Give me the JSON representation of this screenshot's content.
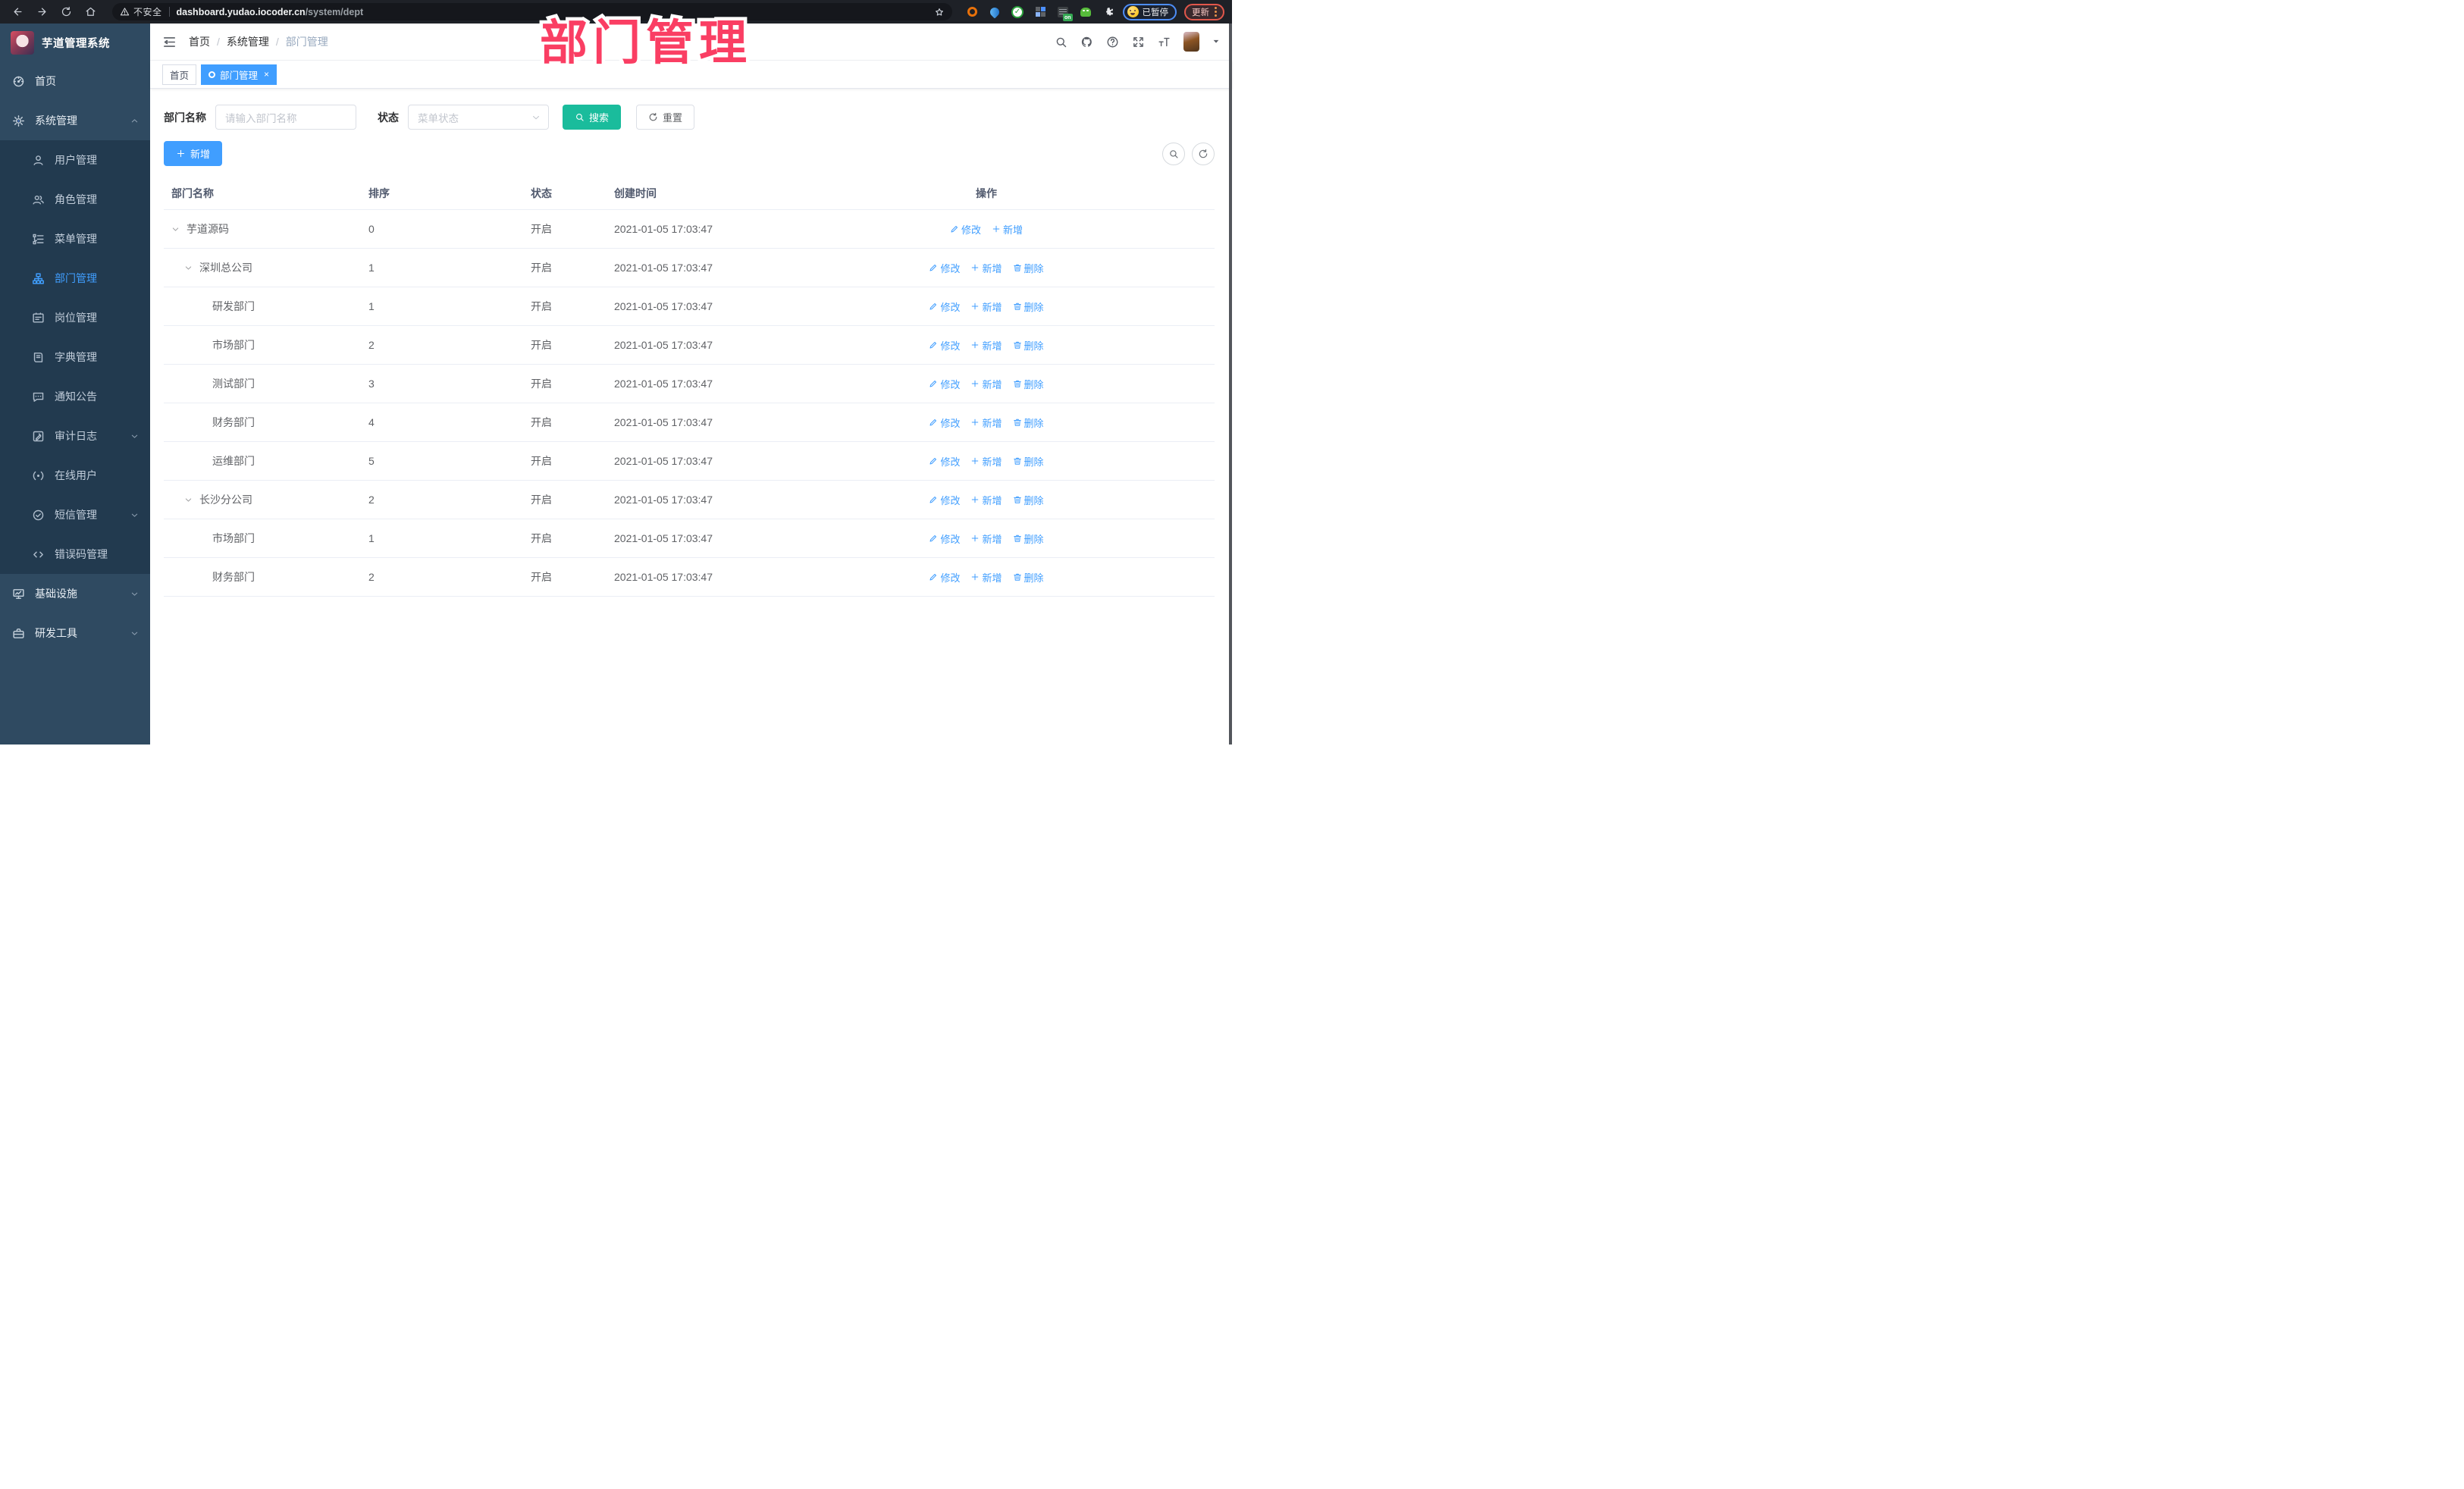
{
  "annotation": {
    "title": "部门管理"
  },
  "browser": {
    "insecure_label": "不安全",
    "url_host": "dashboard.yudao.iocoder.cn",
    "url_path": "/system/dept",
    "profile_label": "已暂停",
    "update_label": "更新",
    "extensions": [
      {
        "icon": "orange-ring-extension-icon"
      },
      {
        "icon": "blue-pin-extension-icon"
      },
      {
        "icon": "green-check-extension-icon"
      },
      {
        "icon": "grid-extension-icon"
      },
      {
        "icon": "adblock-extension-icon",
        "badge": "on"
      },
      {
        "icon": "green-bot-extension-icon"
      },
      {
        "icon": "puzzle-extension-icon"
      }
    ]
  },
  "sidebar": {
    "title": "芋道管理系统",
    "items": [
      {
        "label": "首页",
        "icon": "dashboard-icon",
        "level": 0
      },
      {
        "label": "系统管理",
        "icon": "gear-icon",
        "level": 0,
        "chevron": "up"
      },
      {
        "label": "用户管理",
        "icon": "user-icon",
        "level": 1
      },
      {
        "label": "角色管理",
        "icon": "role-icon",
        "level": 1
      },
      {
        "label": "菜单管理",
        "icon": "menu-tree-icon",
        "level": 1
      },
      {
        "label": "部门管理",
        "icon": "dept-icon",
        "level": 1,
        "active": true
      },
      {
        "label": "岗位管理",
        "icon": "post-icon",
        "level": 1
      },
      {
        "label": "字典管理",
        "icon": "dict-icon",
        "level": 1
      },
      {
        "label": "通知公告",
        "icon": "notice-icon",
        "level": 1
      },
      {
        "label": "审计日志",
        "icon": "log-icon",
        "level": 1,
        "chevron": "down"
      },
      {
        "label": "在线用户",
        "icon": "online-icon",
        "level": 1
      },
      {
        "label": "短信管理",
        "icon": "sms-icon",
        "level": 1,
        "chevron": "down"
      },
      {
        "label": "错误码管理",
        "icon": "code-icon",
        "level": 1
      },
      {
        "label": "基础设施",
        "icon": "infra-icon",
        "level": 0,
        "chevron": "down"
      },
      {
        "label": "研发工具",
        "icon": "tool-icon",
        "level": 0,
        "chevron": "down"
      }
    ]
  },
  "header": {
    "breadcrumb": [
      {
        "label": "首页",
        "muted": false
      },
      {
        "label": "系统管理",
        "muted": false
      },
      {
        "label": "部门管理",
        "muted": true
      }
    ]
  },
  "tabs": [
    {
      "label": "首页",
      "active": false,
      "closable": false
    },
    {
      "label": "部门管理",
      "active": true,
      "closable": true
    }
  ],
  "filters": {
    "dept_label": "部门名称",
    "dept_placeholder": "请输入部门名称",
    "status_label": "状态",
    "status_placeholder": "菜单状态",
    "search_label": "搜索",
    "reset_label": "重置"
  },
  "toolbar": {
    "add_label": "新增"
  },
  "table": {
    "headers": [
      "部门名称",
      "排序",
      "状态",
      "创建时间",
      "操作"
    ],
    "action_labels": {
      "edit": "修改",
      "add": "新增",
      "delete": "删除"
    },
    "rows": [
      {
        "indent": 0,
        "arrow": true,
        "name": "芋道源码",
        "sort": "0",
        "status": "开启",
        "time": "2021-01-05 17:03:47",
        "actions": [
          "edit",
          "add"
        ]
      },
      {
        "indent": 1,
        "arrow": true,
        "name": "深圳总公司",
        "sort": "1",
        "status": "开启",
        "time": "2021-01-05 17:03:47",
        "actions": [
          "edit",
          "add",
          "delete"
        ]
      },
      {
        "indent": 2,
        "arrow": false,
        "name": "研发部门",
        "sort": "1",
        "status": "开启",
        "time": "2021-01-05 17:03:47",
        "actions": [
          "edit",
          "add",
          "delete"
        ]
      },
      {
        "indent": 2,
        "arrow": false,
        "name": "市场部门",
        "sort": "2",
        "status": "开启",
        "time": "2021-01-05 17:03:47",
        "actions": [
          "edit",
          "add",
          "delete"
        ]
      },
      {
        "indent": 2,
        "arrow": false,
        "name": "测试部门",
        "sort": "3",
        "status": "开启",
        "time": "2021-01-05 17:03:47",
        "actions": [
          "edit",
          "add",
          "delete"
        ]
      },
      {
        "indent": 2,
        "arrow": false,
        "name": "财务部门",
        "sort": "4",
        "status": "开启",
        "time": "2021-01-05 17:03:47",
        "actions": [
          "edit",
          "add",
          "delete"
        ]
      },
      {
        "indent": 2,
        "arrow": false,
        "name": "运维部门",
        "sort": "5",
        "status": "开启",
        "time": "2021-01-05 17:03:47",
        "actions": [
          "edit",
          "add",
          "delete"
        ]
      },
      {
        "indent": 1,
        "arrow": true,
        "name": "长沙分公司",
        "sort": "2",
        "status": "开启",
        "time": "2021-01-05 17:03:47",
        "actions": [
          "edit",
          "add",
          "delete"
        ]
      },
      {
        "indent": 2,
        "arrow": false,
        "name": "市场部门",
        "sort": "1",
        "status": "开启",
        "time": "2021-01-05 17:03:47",
        "actions": [
          "edit",
          "add",
          "delete"
        ]
      },
      {
        "indent": 2,
        "arrow": false,
        "name": "财务部门",
        "sort": "2",
        "status": "开启",
        "time": "2021-01-05 17:03:47",
        "actions": [
          "edit",
          "add",
          "delete"
        ]
      }
    ]
  },
  "colors": {
    "accent": "#409EFF",
    "search_button": "#1abc9c",
    "annotation_pink": "#fa3e63",
    "sidebar_bg": "#2f4a61",
    "sidebar_submenu_bg": "#223a4f"
  }
}
